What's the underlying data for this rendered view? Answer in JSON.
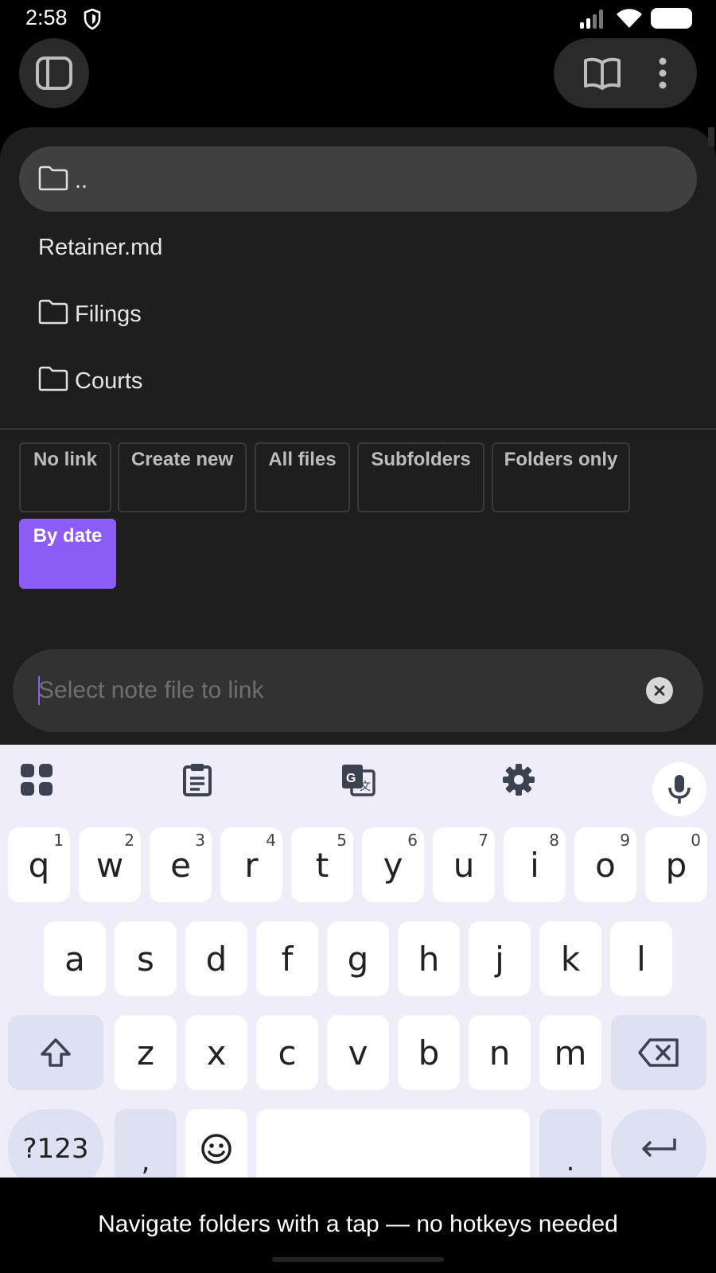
{
  "status": {
    "time": "2:58"
  },
  "file_list": {
    "items": [
      {
        "label": "..",
        "type": "folder",
        "selected": true
      },
      {
        "label": "Retainer.md",
        "type": "file",
        "selected": false
      },
      {
        "label": "Filings",
        "type": "folder",
        "selected": false
      },
      {
        "label": "Courts",
        "type": "folder",
        "selected": false
      }
    ]
  },
  "filters": {
    "chips": [
      {
        "label": "No link",
        "active": false
      },
      {
        "label": "Create new",
        "active": false
      },
      {
        "label": "All files",
        "active": false
      },
      {
        "label": "Subfolders",
        "active": false
      },
      {
        "label": "Folders only",
        "active": false
      },
      {
        "label": "By date",
        "active": true
      }
    ]
  },
  "search": {
    "placeholder": "Select note file to link",
    "value": ""
  },
  "keyboard": {
    "row1": [
      {
        "key": "q",
        "hint": "1"
      },
      {
        "key": "w",
        "hint": "2"
      },
      {
        "key": "e",
        "hint": "3"
      },
      {
        "key": "r",
        "hint": "4"
      },
      {
        "key": "t",
        "hint": "5"
      },
      {
        "key": "y",
        "hint": "6"
      },
      {
        "key": "u",
        "hint": "7"
      },
      {
        "key": "i",
        "hint": "8"
      },
      {
        "key": "o",
        "hint": "9"
      },
      {
        "key": "p",
        "hint": "0"
      }
    ],
    "row2": [
      "a",
      "s",
      "d",
      "f",
      "g",
      "h",
      "j",
      "k",
      "l"
    ],
    "row3": [
      "z",
      "x",
      "c",
      "v",
      "b",
      "n",
      "m"
    ],
    "symbols_label": "?123",
    "comma_label": ",",
    "period_label": "."
  },
  "colors": {
    "accent": "#8b5cf6",
    "sheet": "#1e1e1e",
    "keyboard_bg": "#efedf7"
  },
  "footer": {
    "caption": "Navigate folders with a tap — no hotkeys needed"
  }
}
